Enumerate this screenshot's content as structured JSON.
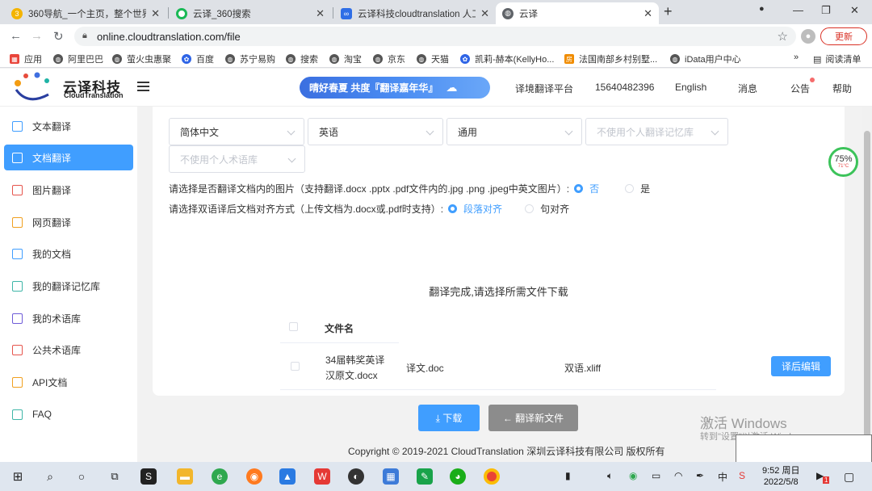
{
  "browser": {
    "tabs": [
      {
        "title": "360导航_一个主页，整个世界"
      },
      {
        "title": "云译_360搜索"
      },
      {
        "title": "云译科技cloudtranslation 人工智"
      },
      {
        "title": "云译"
      }
    ],
    "url": "online.cloudtranslation.com/file",
    "update_label": "更新",
    "bookmarks": [
      "应用",
      "阿里巴巴",
      "萤火虫惠聚",
      "百度",
      "苏宁易购",
      "搜索",
      "淘宝",
      "京东",
      "天猫",
      "凯莉-赫本(KellyHo...",
      "法国南部乡村别墅...",
      "iData用户中心"
    ],
    "reading_list": "阅读清单"
  },
  "header": {
    "brand_cn": "云译科技",
    "brand_en": "CloudTranslation",
    "banner": "晴好春夏 共度『翻译嘉年华』",
    "nav": [
      "译境翻译平台",
      "15640482396",
      "English",
      "消息",
      "公告",
      "帮助"
    ]
  },
  "sidebar": {
    "items": [
      {
        "label": "文本翻译"
      },
      {
        "label": "文档翻译"
      },
      {
        "label": "图片翻译"
      },
      {
        "label": "网页翻译"
      },
      {
        "label": "我的文档"
      },
      {
        "label": "我的翻译记忆库"
      },
      {
        "label": "我的术语库"
      },
      {
        "label": "公共术语库"
      },
      {
        "label": "API文档"
      },
      {
        "label": "FAQ"
      }
    ]
  },
  "form": {
    "source_lang": "简体中文",
    "target_lang": "英语",
    "domain": "通用",
    "memory_placeholder": "不使用个人翻译记忆库",
    "term_placeholder": "不使用个人术语库",
    "image_question": "请选择是否翻译文档内的图片（支持翻译.docx .pptx .pdf文件内的.jpg .png .jpeg中英文图片）:",
    "image_no": "否",
    "image_yes": "是",
    "align_question": "请选择双语译后文档对齐方式（上传文档为.docx或.pdf时支持）:",
    "align_paragraph": "段落对齐",
    "align_sentence": "句对齐"
  },
  "result": {
    "message": "翻译完成,请选择所需文件下载",
    "column_filename": "文件名",
    "row": {
      "original_line1": "34届韩奖英译",
      "original_line2": "汉原文.docx",
      "translation": "译文.doc",
      "bilingual": "双语.xliff",
      "edit_label": "译后编辑"
    },
    "download_label": "⤓ 下载",
    "new_label": "← 翻译新文件"
  },
  "footer": "Copyright © 2019-2021 CloudTranslation 深圳云译科技有限公司 版权所有",
  "gauge": {
    "value": "75%",
    "temp": "71°C"
  },
  "watermark": {
    "line1": "激活 Windows",
    "line2": "转到\"设置\"以激活 Windows"
  },
  "taskbar": {
    "time": "9:52 周日",
    "date": "2022/5/8",
    "ime": "中",
    "badge": "1"
  },
  "colors": {
    "accent": "#409eff",
    "gauge": "#3cc35a"
  }
}
